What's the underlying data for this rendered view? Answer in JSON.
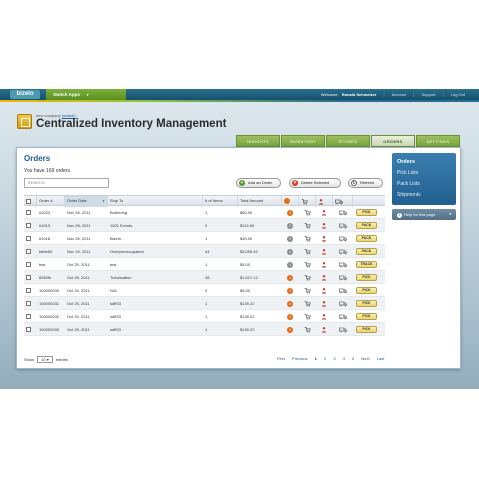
{
  "topbar": {
    "logo": "bizelo",
    "switch_apps": "Switch Apps",
    "welcome_prefix": "Welcome,",
    "user": "Ronald Schmelzer",
    "links": [
      "Account",
      "Support",
      "Log Out"
    ]
  },
  "header": {
    "company_prefix": "new company",
    "company_link": "(switch)",
    "title": "Centralized Inventory Management"
  },
  "tabs": [
    "INSIGHTS",
    "INVENTORY",
    "STORES",
    "ORDERS",
    "SETTINGS"
  ],
  "active_tab": "ORDERS",
  "main": {
    "title": "Orders",
    "order_count": "You have 169 orders",
    "search_placeholder": "SEARCH",
    "buttons": {
      "add": "Add an Order",
      "delete": "Delete Selected",
      "refresh": "Refresh"
    },
    "columns": [
      "Order #",
      "Order Date",
      "Ship To",
      "# of Items",
      "Total Amount"
    ],
    "rows": [
      {
        "order": "#1023",
        "date": "Nov 28, 2011",
        "ship_to": "Bothering",
        "items": "1",
        "total": "$60.00",
        "info": "orange",
        "action": "PICK"
      },
      {
        "order": "#1019",
        "date": "Nov 28, 2011",
        "ship_to": "1001 Events",
        "items": "2",
        "total": "$113.50",
        "info": "grey",
        "action": "PACK"
      },
      {
        "order": "#1018",
        "date": "Nov 28, 2011",
        "ship_to": "Bizelo",
        "items": "1",
        "total": "$30.00",
        "info": "grey",
        "action": "PACK"
      },
      {
        "order": "b8be60",
        "date": "Nov 15, 2011",
        "ship_to": "Overpreoccupation",
        "items": "44",
        "total": "$3,059.42",
        "info": "grey",
        "action": "PACK"
      },
      {
        "order": "test",
        "date": "Oct 25, 2011",
        "ship_to": "test",
        "items": "1",
        "total": "$5.00",
        "info": "grey",
        "action": "TRACK"
      },
      {
        "order": "8350fb",
        "date": "Oct 25, 2011",
        "ship_to": "Tubulization",
        "items": "28",
        "total": "$1,517.12",
        "info": "orange",
        "action": "PICK"
      },
      {
        "order": "100000039",
        "date": "Oct 25, 2011",
        "ship_to": "N/A",
        "items": "0",
        "total": "$5.00",
        "info": "orange",
        "action": "PICK"
      },
      {
        "order": "100000031",
        "date": "Oct 25, 2011",
        "ship_to": "sdff33",
        "items": "1",
        "total": "$139.22",
        "info": "orange",
        "action": "PICK"
      },
      {
        "order": "100000032",
        "date": "Oct 25, 2011",
        "ship_to": "sdff33",
        "items": "1",
        "total": "$139.22",
        "info": "orange",
        "action": "PICK"
      },
      {
        "order": "100000033",
        "date": "Oct 25, 2011",
        "ship_to": "sdff33",
        "items": "1",
        "total": "$139.22",
        "info": "orange",
        "action": "PICK"
      }
    ],
    "footer": {
      "show_label": "Show",
      "show_value": "10",
      "entries_label": "entries",
      "pager": [
        "First",
        "Previous",
        "1",
        "2",
        "3",
        "4",
        "5",
        "Next",
        "Last"
      ],
      "current_page": "1"
    }
  },
  "sidebar": {
    "items": [
      "Orders",
      "Pick Lists",
      "Pack Lists",
      "Shipments"
    ],
    "active": "Orders",
    "help": "Help for this page"
  },
  "colors": {
    "accent_blue": "#1d5f96",
    "tab_green": "#7aa33c",
    "info_orange": "#e36a16"
  }
}
